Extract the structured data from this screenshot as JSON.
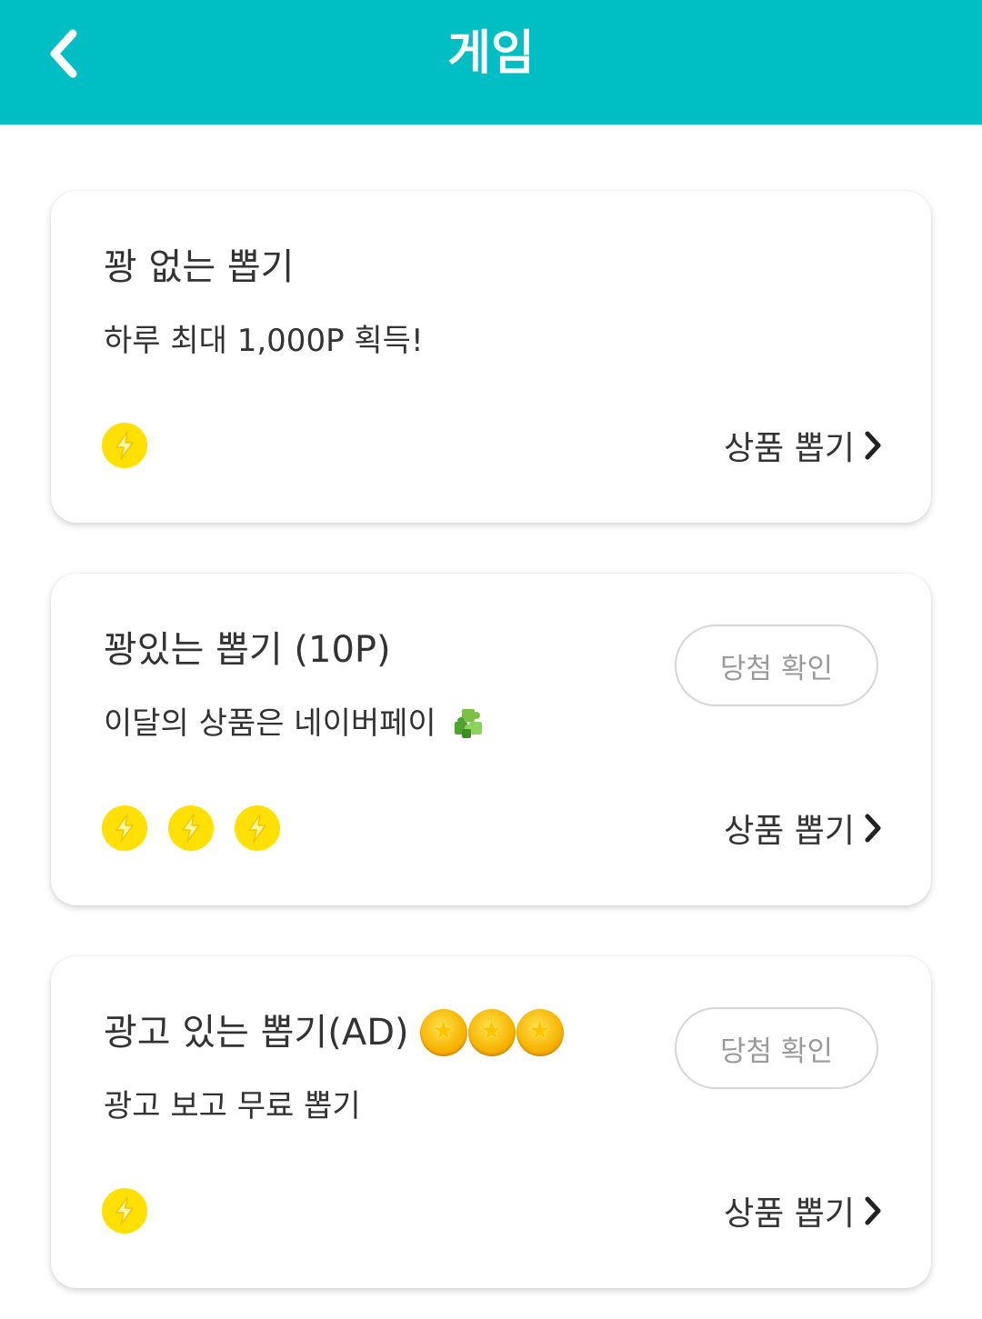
{
  "header": {
    "title": "게임",
    "background_color": "#00BFC4",
    "back_icon": "chevron-left-icon"
  },
  "cards": [
    {
      "title": "꽝 없는 뽑기",
      "subtitle": "하루 최대 1,000P 획득!",
      "bolt_count": 1,
      "draw_label": "상품 뽑기"
    },
    {
      "title": "꽝있는 뽑기 (10P)",
      "subtitle": "이달의 상품은 네이버페이",
      "subtitle_icon": "puzzle-piece-icon",
      "win_check_label": "당첨 확인",
      "bolt_count": 3,
      "draw_label": "상품 뽑기"
    },
    {
      "title": "광고 있는 뽑기(AD)",
      "title_icons": [
        "coin-icon",
        "coin-icon",
        "coin-icon"
      ],
      "subtitle": "광고 보고 무료 뽑기",
      "win_check_label": "당첨 확인",
      "bolt_count": 1,
      "draw_label": "상품 뽑기"
    }
  ],
  "colors": {
    "accent": "#00BFC4",
    "bolt": "#FFE000",
    "text": "#333333",
    "button_text": "#9A9A9A"
  }
}
